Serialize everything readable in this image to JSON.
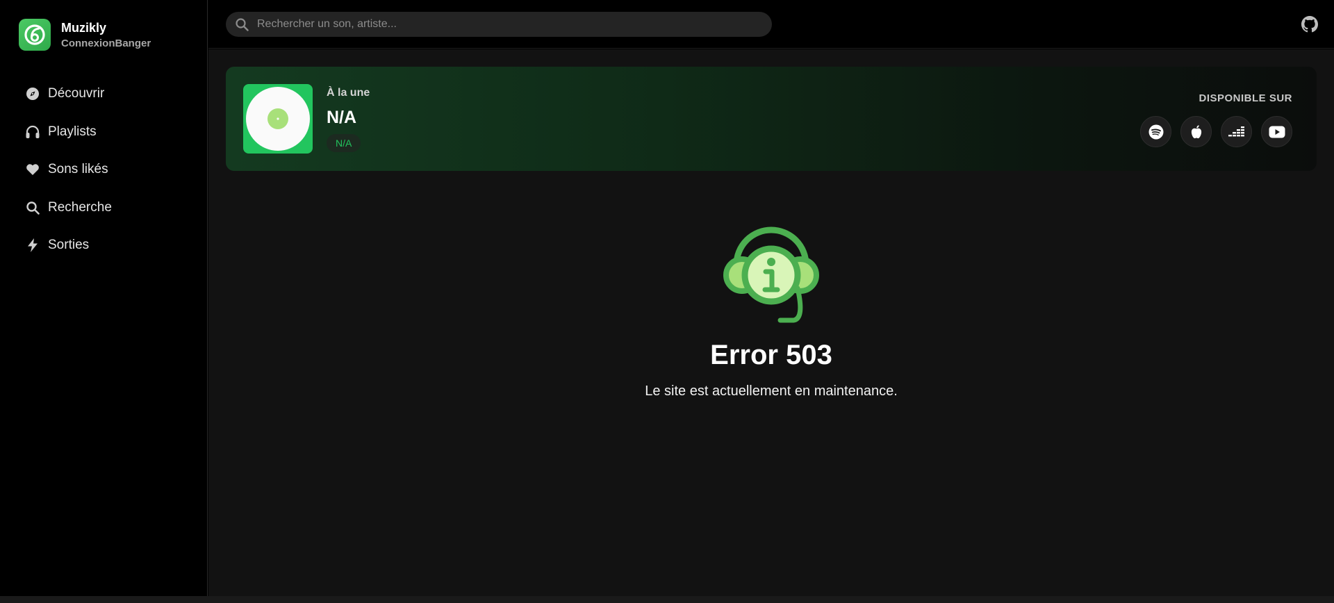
{
  "brand": {
    "name": "Muzikly",
    "subtitle": "ConnexionBanger"
  },
  "nav": [
    {
      "label": "Découvrir",
      "icon": "compass-icon"
    },
    {
      "label": "Playlists",
      "icon": "headphones-icon"
    },
    {
      "label": "Sons likés",
      "icon": "heart-icon"
    },
    {
      "label": "Recherche",
      "icon": "search-icon"
    },
    {
      "label": "Sorties",
      "icon": "bolt-icon"
    }
  ],
  "search": {
    "placeholder": "Rechercher un son, artiste..."
  },
  "featured": {
    "kicker": "À la une",
    "title": "N/A",
    "tag": "N/A",
    "available_label": "DISPONIBLE SUR",
    "platforms": [
      "spotify-icon",
      "apple-icon",
      "deezer-icon",
      "youtube-icon"
    ]
  },
  "error": {
    "title": "Error 503",
    "message": "Le site est actuellement en maintenance."
  },
  "colors": {
    "accent": "#22c55e",
    "background": "#121212",
    "sidebar": "#000000"
  }
}
